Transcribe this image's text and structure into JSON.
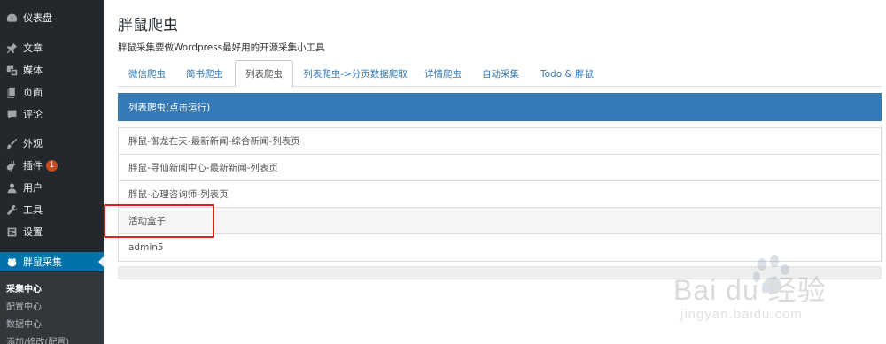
{
  "sidebar": {
    "items": [
      {
        "label": "仪表盘",
        "icon": "dashboard-icon"
      },
      {
        "label": "文章",
        "icon": "pin-icon"
      },
      {
        "label": "媒体",
        "icon": "media-icon"
      },
      {
        "label": "页面",
        "icon": "page-icon"
      },
      {
        "label": "评论",
        "icon": "comment-icon"
      },
      {
        "label": "外观",
        "icon": "brush-icon"
      },
      {
        "label": "插件",
        "icon": "plugin-icon",
        "badge": "1"
      },
      {
        "label": "用户",
        "icon": "user-icon"
      },
      {
        "label": "工具",
        "icon": "wrench-icon"
      },
      {
        "label": "设置",
        "icon": "settings-icon"
      },
      {
        "label": "胖鼠采集",
        "icon": "frog-icon"
      }
    ],
    "submenu": [
      "采集中心",
      "配置中心",
      "数据中心",
      "添加/修改(配置)"
    ]
  },
  "main": {
    "title": "胖鼠爬虫",
    "subtitle": "胖鼠采集要做Wordpress最好用的开源采集小工具",
    "tabs": [
      "微信爬虫",
      "简书爬虫",
      "列表爬虫",
      "列表爬虫->分页数据爬取",
      "详情爬虫",
      "自动采集",
      "Todo & 胖鼠"
    ],
    "active_tab": 2,
    "panel_heading": "列表爬虫(点击运行)",
    "list": [
      "胖鼠-御龙在天-最新新闻-综合新闻-列表页",
      "胖鼠-寻仙新闻中心-最新新闻-列表页",
      "胖鼠-心理咨询师-列表页",
      "活动盒子",
      "admin5"
    ]
  },
  "watermark": {
    "logo_text": "Bai du 经验",
    "url": "jingyan.baidu.com"
  },
  "colors": {
    "sidebar_bg": "#23282d",
    "accent": "#0073aa",
    "panel_heading": "#337ab7",
    "highlight": "#e02020",
    "badge": "#ca4a1f"
  }
}
